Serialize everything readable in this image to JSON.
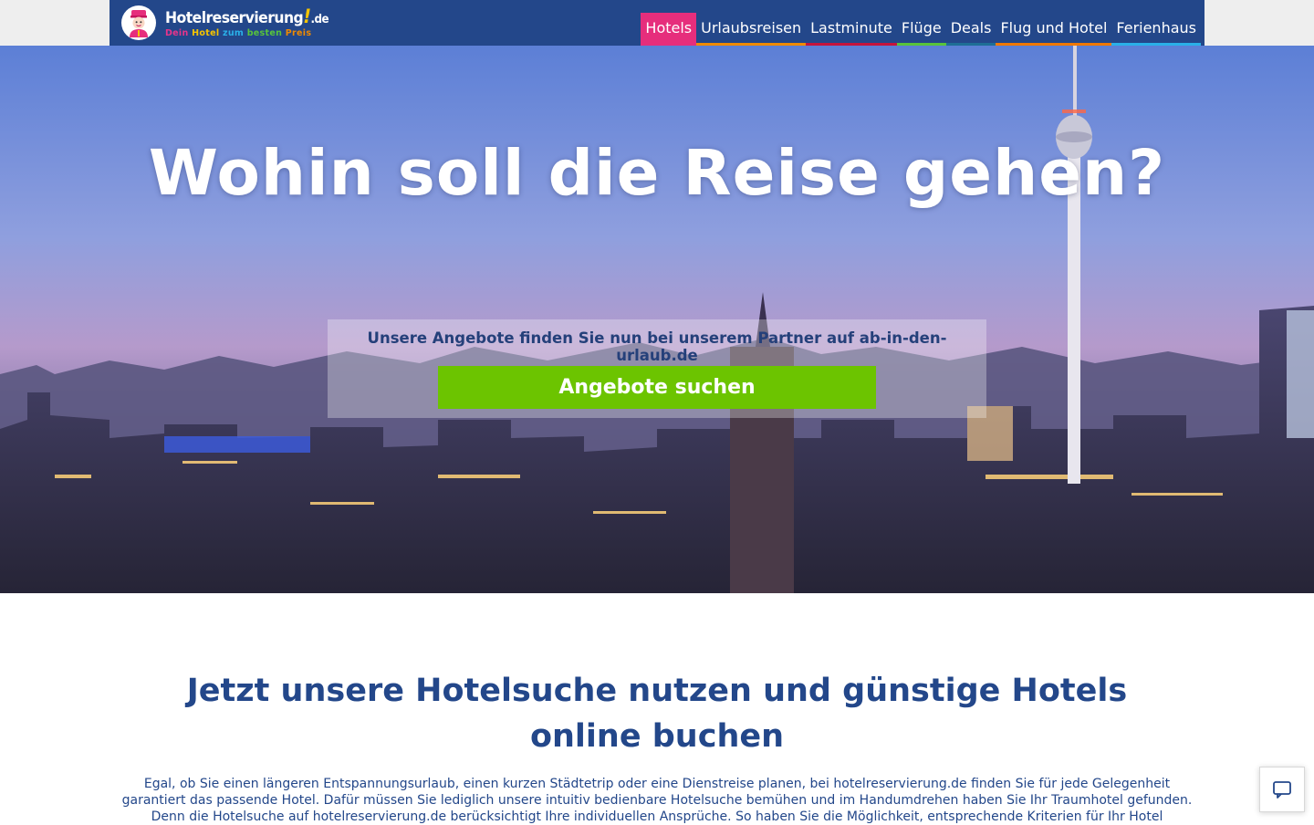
{
  "brand": {
    "name_main": "Hotelreservierung",
    "name_bang": "!",
    "name_tld": ".de",
    "tagline": {
      "dein": "Dein",
      "hotel": "Hotel",
      "zum": "zum",
      "besten": "besten",
      "preis": "Preis"
    }
  },
  "nav": {
    "items": [
      {
        "label": "Hotels",
        "color": "#e62e7c"
      },
      {
        "label": "Urlaubsreisen",
        "color": "#f08a00"
      },
      {
        "label": "Lastminute",
        "color": "#c4143c"
      },
      {
        "label": "Flüge",
        "color": "#58c43b"
      },
      {
        "label": "Deals",
        "color": "#1e6e96"
      },
      {
        "label": "Flug und Hotel",
        "color": "#f07800"
      },
      {
        "label": "Ferienhaus",
        "color": "#2ab0e8"
      }
    ],
    "active_index": 0
  },
  "hero": {
    "title": "Wohin soll die Reise gehen?",
    "offer_text": "Unsere Angebote finden Sie nun bei unserem Partner auf ab-in-den-urlaub.de",
    "cta_label": "Angebote suchen"
  },
  "content": {
    "heading": "Jetzt unsere Hotelsuche nutzen und günstige Hotels online buchen",
    "paragraph": "Egal, ob Sie einen längeren Entspannungsurlaub, einen kurzen Städtetrip oder eine Dienstreise planen, bei hotelreservierung.de finden Sie für jede Gelegenheit garantiert das passende Hotel. Dafür müssen Sie lediglich unsere intuitiv bedienbare Hotelsuche bemühen und im Handumdrehen haben Sie Ihr Traumhotel gefunden. Denn die Hotelsuche auf hotelreservierung.de berücksichtigt Ihre individuellen Ansprüche. So haben Sie die Möglichkeit, entsprechende Kriterien für Ihr Hotel"
  },
  "icons": {
    "chat": "chat-icon",
    "mascot": "hotel-mascot-icon"
  },
  "colors": {
    "header_bg": "#23478a",
    "accent_pink": "#e62e7c",
    "cta_green": "#6cc400",
    "text_blue": "#23478a"
  }
}
